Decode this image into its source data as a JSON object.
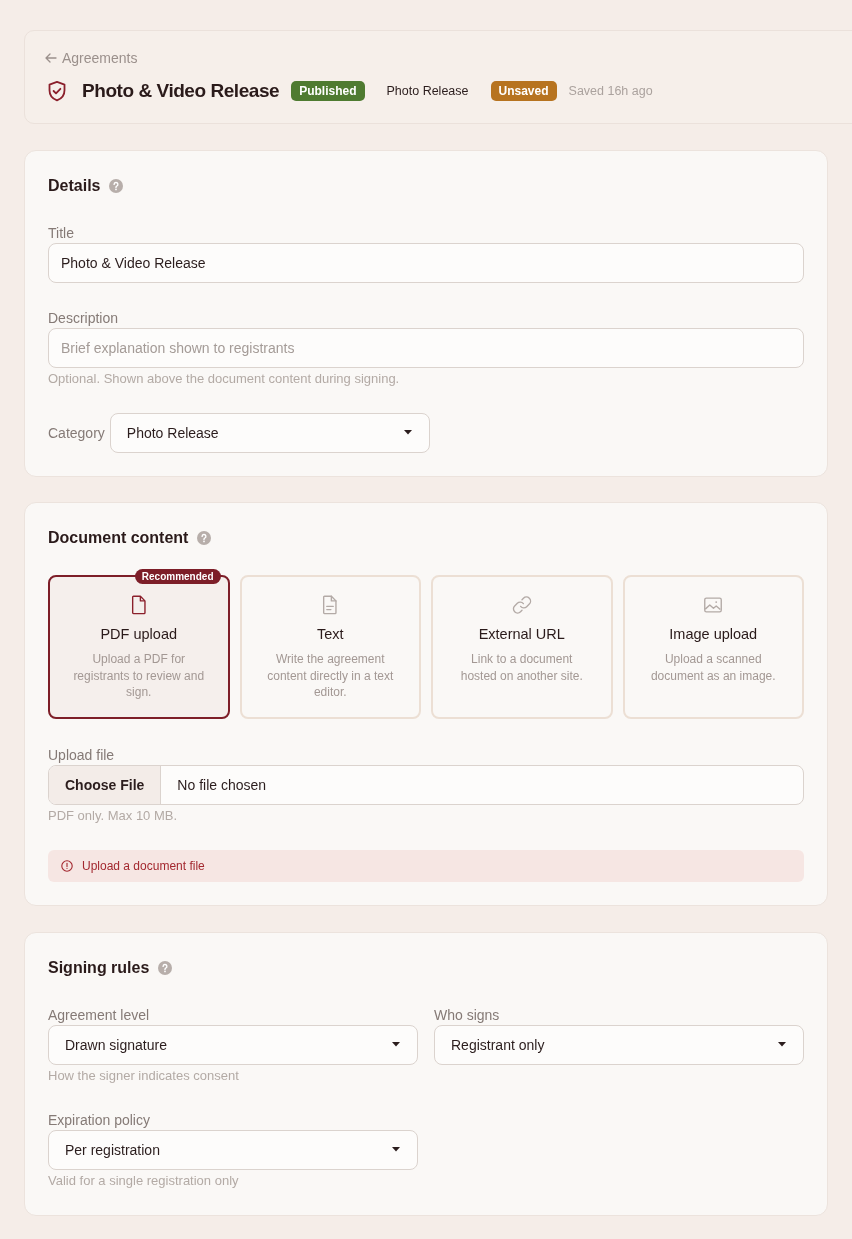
{
  "header": {
    "back_link": "Agreements",
    "title": "Photo & Video Release",
    "status_badge": "Published",
    "category": "Photo Release",
    "save_badge": "Unsaved",
    "saved_time": "Saved 16h ago"
  },
  "details": {
    "heading": "Details",
    "fields": [
      {
        "kind": "text",
        "label": "Title",
        "value": "Photo & Video Release"
      },
      {
        "kind": "text",
        "label": "Description",
        "placeholder": "Brief explanation shown to registrants",
        "hint": "Optional. Shown above the document content during signing."
      },
      {
        "kind": "inline-select",
        "label": "Category",
        "value": "Photo Release"
      }
    ]
  },
  "document_content": {
    "heading": "Document content",
    "options": [
      {
        "kind": "pdf",
        "title": "PDF upload",
        "description": "Upload a PDF for registrants to review and sign.",
        "badge": "Recommended",
        "selected": true
      },
      {
        "kind": "text",
        "title": "Text",
        "description": "Write the agreement content directly in a text editor.",
        "selected": false
      },
      {
        "kind": "url",
        "title": "External URL",
        "description": "Link to a document hosted on another site.",
        "selected": false
      },
      {
        "kind": "image",
        "title": "Image upload",
        "description": "Upload a scanned document as an image.",
        "selected": false
      }
    ],
    "upload": {
      "label": "Upload file",
      "button": "Choose File",
      "value": "No file chosen",
      "hint": "PDF only. Max 10 MB."
    },
    "error": "Upload a document file"
  },
  "signing_rules": {
    "heading": "Signing rules",
    "fields": [
      {
        "kind": "select",
        "label": "Agreement level",
        "value": "Drawn signature",
        "hint": "How the signer indicates consent"
      },
      {
        "kind": "select",
        "label": "Who signs",
        "value": "Registrant only"
      },
      {
        "kind": "select",
        "label": "Expiration policy",
        "value": "Per registration",
        "hint": "Valid for a single registration only"
      }
    ]
  }
}
